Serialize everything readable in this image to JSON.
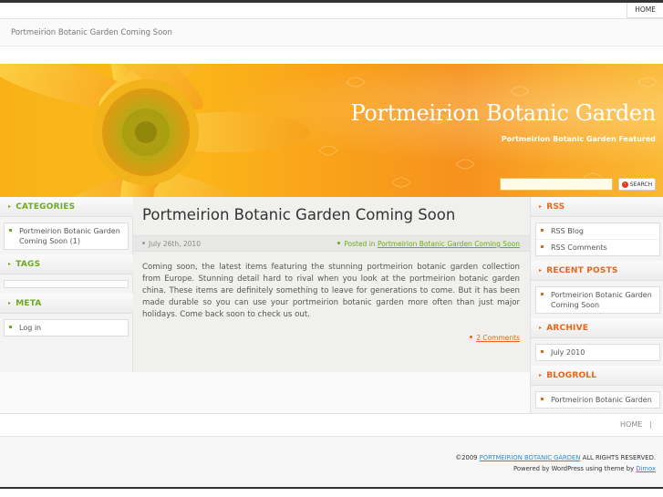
{
  "nav": {
    "home": "HOME"
  },
  "breadcrumb": "Portmeirion Botanic Garden Coming Soon",
  "header": {
    "title": "Portmeirion Botanic Garden",
    "description": "Portmeirion Botanic Garden Featured",
    "search_value": "",
    "search_button": "SEARCH"
  },
  "left_sidebar": {
    "categories": {
      "title": "CATEGORIES",
      "items": [
        "Portmeirion Botanic Garden Coming Soon (1)"
      ]
    },
    "tags": {
      "title": "TAGS"
    },
    "meta": {
      "title": "META",
      "items": [
        "Log in"
      ]
    }
  },
  "post": {
    "title": "Portmeirion Botanic Garden Coming Soon",
    "date": "July 26th, 2010",
    "posted_in_label": "Posted in",
    "category_link": "Portmeirion Botanic Garden Coming Soon",
    "body": "Coming soon, the latest items featuring the stunning portmeirion botanic garden collection from Europe. Stunning detail hard to rival when you look at the portmeirion botanic garden china. These items are definitely something to leave for generations to come. But it has been made durable so you can use your portmeirion botanic garden more often than just major holidays. Come back soon to check us out.",
    "comments": "2 Comments"
  },
  "right_sidebar": {
    "rss": {
      "title": "RSS",
      "items": [
        "RSS Blog",
        "RSS Comments"
      ]
    },
    "recent_posts": {
      "title": "RECENT POSTS",
      "items": [
        "Portmeirion Botanic Garden Coming Soon"
      ]
    },
    "archive": {
      "title": "ARCHIVE",
      "items": [
        "July 2010"
      ]
    },
    "blogroll": {
      "title": "BLOGROLL",
      "items": [
        "Portmeirion Botanic Garden"
      ]
    }
  },
  "footer": {
    "home": "HOME",
    "separator": "|",
    "copyright_prefix": "©2009",
    "site_link": "PORTMEIRION BOTANIC GARDEN",
    "rights": "ALL RIGHTS RESERVED.",
    "powered_prefix": "Powered by WordPress using theme by",
    "theme_author": "Dimox"
  },
  "colors": {
    "accent_green": "#6bab1e",
    "accent_orange": "#e8651b",
    "link_blue": "#2a8fd0",
    "header_orange": "#f9a21a"
  }
}
